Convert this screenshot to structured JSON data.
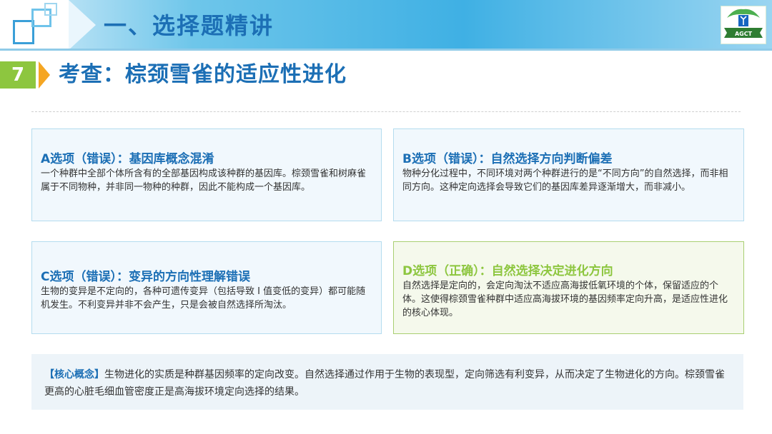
{
  "header": {
    "section_title": "一、选择题精讲",
    "logo_text": "AGCT",
    "colors": {
      "band": "#3fb0e4",
      "title": "#1c6fb5",
      "logo_green": "#2e7d32"
    }
  },
  "question": {
    "number": "7",
    "title": "考查：棕颈雪雀的适应性进化",
    "colors": {
      "number_bg": "#8dc63f",
      "arrow": "#f5a623"
    }
  },
  "options": [
    {
      "title": "A选项（错误）：基因库概念混淆",
      "body": "一个种群中全部个体所含有的全部基因构成该种群的基因库。棕颈雪雀和树麻雀属于不同物种，并非同一物种的种群，因此不能构成一个基因库。",
      "status": "错误"
    },
    {
      "title": "B选项（错误）：自然选择方向判断偏差",
      "body": "物种分化过程中，不同环境对两个种群进行的是“不同方向”的自然选择，而非相同方向。这种定向选择会导致它们的基因库差异逐渐增大，而非减小。",
      "status": "错误"
    },
    {
      "title": "C选项（错误）：变异的方向性理解错误",
      "body": "生物的变异是不定向的，各种可遗传变异（包括导致 I 值变低的变异）都可能随机发生。不利变异并非不会产生，只是会被自然选择所淘汰。",
      "status": "错误"
    },
    {
      "title": "D选项（正确）：自然选择决定进化方向",
      "body": "自然选择是定向的，会定向淘汰不适应高海拔低氧环境的个体，保留适应的个体。这使得棕颈雪雀种群中适应高海拔环境的基因频率定向升高，是适应性进化的核心体现。",
      "status": "正确"
    }
  ],
  "concept": {
    "tag": "【核心概念】",
    "text": "生物进化的实质是种群基因频率的定向改变。自然选择通过作用于生物的表现型，定向筛选有利变异，从而决定了生物进化的方向。棕颈雪雀更高的心脏毛细血管密度正是高海拔环境定向选择的结果。"
  }
}
